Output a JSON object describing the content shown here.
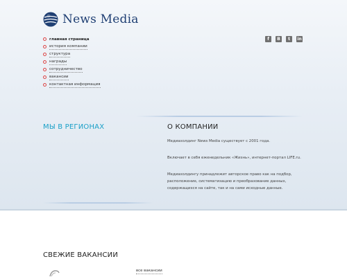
{
  "header": {
    "logo_text": "News Media"
  },
  "nav": {
    "items": [
      {
        "label": "главная страница",
        "active": true
      },
      {
        "label": "история компании"
      },
      {
        "label": "структура"
      },
      {
        "label": "награды"
      },
      {
        "label": "сотрудничество"
      },
      {
        "label": "вакансии"
      },
      {
        "label": "контактная информация"
      }
    ]
  },
  "social": {
    "icons": [
      "facebook-icon",
      "vkontakte-icon",
      "twitter-icon",
      "linkedin-icon"
    ],
    "glyphs": [
      "f",
      "B",
      "t",
      "in"
    ]
  },
  "regions": {
    "title": "МЫ В РЕГИОНАХ"
  },
  "about": {
    "title": "О КОМПАНИИ",
    "paragraphs": [
      "Медиахолдинг News Media существует с 2001 года.",
      "Включает в себя еженедельник «Жизнь», интернет-портал LIFE.ru.",
      "Медиахолдингу принадлежит авторское право как на подбор, расположение, систематизацию и преобразование данных, содержащихся на сайте, так и на сами исходные данные."
    ]
  },
  "vacancies": {
    "title": "СВЕЖИЕ ВАКАНСИИ",
    "all_link": "все вакансии"
  },
  "colors": {
    "accent": "#1aa0c8",
    "logo": "#1f3f73",
    "bullet": "#dd4444"
  }
}
